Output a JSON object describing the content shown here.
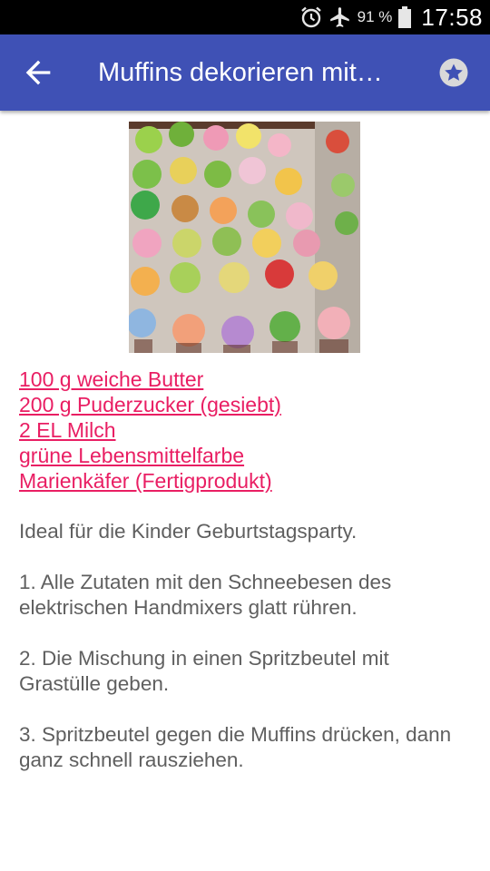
{
  "status_bar": {
    "battery_percent": "91 %",
    "time": "17:58",
    "icons": [
      "alarm-icon",
      "airplane-icon",
      "battery-icon"
    ]
  },
  "app_bar": {
    "title": "Muffins dekorieren mit…",
    "back_icon": "arrow-back-icon",
    "favorite_icon": "star-icon",
    "color": "#3f51b5"
  },
  "recipe": {
    "image_alt": "cupcakes-photo",
    "ingredients": [
      "100 g weiche Butter",
      "200 g Puderzucker (gesiebt)",
      "2 EL Milch",
      "grüne Lebensmittelfarbe",
      "Marienkäfer (Fertigprodukt)"
    ],
    "intro": "Ideal für die Kinder Geburtstagsparty.",
    "steps": [
      "1. Alle Zutaten mit den Schneebesen des elektrischen Handmixers glatt rühren.",
      "2. Die Mischung in einen Spritzbeutel mit Grastülle geben.",
      "3. Spritzbeutel gegen die Muffins drücken, dann ganz schnell rausziehen."
    ],
    "link_color": "#e91e63"
  }
}
